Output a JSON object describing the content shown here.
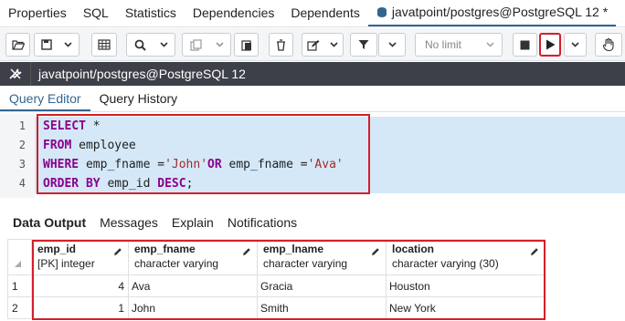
{
  "top_tabs": [
    "Properties",
    "SQL",
    "Statistics",
    "Dependencies",
    "Dependents"
  ],
  "active_tab": {
    "label": "javatpoint/postgres@PostgreSQL 12 *"
  },
  "toolbar": {
    "limit_label": "No limit"
  },
  "connection": {
    "label": "javatpoint/postgres@PostgreSQL 12"
  },
  "editor_tabs": [
    "Query Editor",
    "Query History"
  ],
  "editor": {
    "line_numbers": [
      "1",
      "2",
      "3",
      "4"
    ],
    "lines": [
      [
        {
          "t": "SELECT",
          "c": "kw"
        },
        {
          "t": " *",
          "c": ""
        }
      ],
      [
        {
          "t": "FROM",
          "c": "kw"
        },
        {
          "t": " employee",
          "c": ""
        }
      ],
      [
        {
          "t": "WHERE",
          "c": "kw"
        },
        {
          "t": " emp_fname =",
          "c": ""
        },
        {
          "t": "'John'",
          "c": "str"
        },
        {
          "t": "OR",
          "c": "kw"
        },
        {
          "t": " emp_fname =",
          "c": ""
        },
        {
          "t": "'Ava'",
          "c": "str"
        }
      ],
      [
        {
          "t": "ORDER BY",
          "c": "kw"
        },
        {
          "t": " emp_id ",
          "c": ""
        },
        {
          "t": "DESC",
          "c": "kw"
        },
        {
          "t": ";",
          "c": ""
        }
      ]
    ]
  },
  "output_tabs": [
    "Data Output",
    "Messages",
    "Explain",
    "Notifications"
  ],
  "grid": {
    "columns": [
      {
        "name": "emp_id",
        "type": "[PK] integer"
      },
      {
        "name": "emp_fname",
        "type": "character varying"
      },
      {
        "name": "emp_lname",
        "type": "character varying"
      },
      {
        "name": "location",
        "type": "character varying (30)"
      }
    ],
    "rows": [
      {
        "num": "1",
        "cells": [
          "4",
          "Ava",
          "Gracia",
          "Houston"
        ]
      },
      {
        "num": "2",
        "cells": [
          "1",
          "John",
          "Smith",
          "New York"
        ]
      }
    ]
  },
  "colors": {
    "accent": "#326690",
    "highlight": "#d4e8f8",
    "annotation": "#d61e28",
    "connection_bar": "#3d4049"
  }
}
